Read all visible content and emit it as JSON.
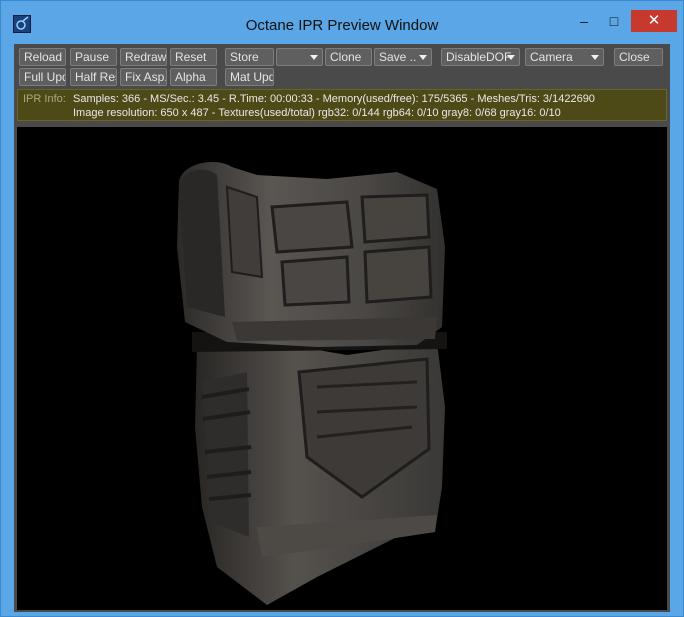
{
  "window": {
    "title": "Octane IPR Preview Window",
    "minimize_icon": "–",
    "maximize_icon": "□",
    "close_icon": "✕"
  },
  "toolbar": {
    "row1": [
      "Reload",
      "Pause",
      "Redraw",
      "Reset",
      "Store",
      "",
      "Clone",
      "Save ..",
      "DisableDOF",
      "Camera",
      "Close"
    ],
    "row2": [
      "Full Upd.",
      "Half Res",
      "Fix Asp.",
      "Alpha",
      "Mat Upd"
    ]
  },
  "info": {
    "label": "IPR Info:",
    "line1": "Samples: 366  -  MS/Sec.: 3.45  -  R.Time: 00:00:33 - Memory(used/free): 175/5365  -  Meshes/Tris: 3/1422690",
    "line2": "Image resolution: 650 x 487 - Textures(used/total) rgb32: 0/144   rgb64: 0/10   gray8: 0/68   gray16: 0/10"
  },
  "colors": {
    "title_bar": "#5aa6e6",
    "close": "#c7382f",
    "panel": "#4a4a4a",
    "info_bg": "#4e4a18",
    "viewport": "#000000"
  }
}
